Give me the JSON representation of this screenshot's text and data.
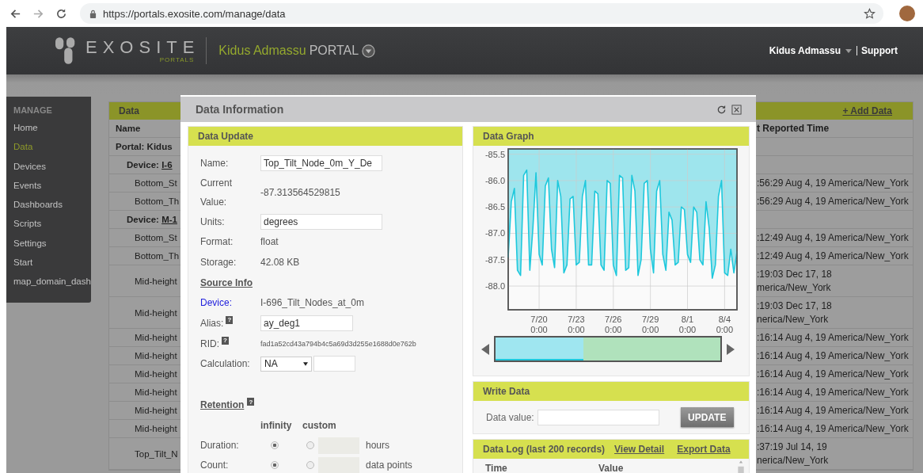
{
  "browser": {
    "url": "https://portals.exosite.com/manage/data"
  },
  "header": {
    "logo_text": "EXOSITE",
    "logo_subtext": "PORTALS",
    "portal_owner": "Kidus Admassu",
    "portal_label": "PORTAL",
    "user_menu": "Kidus Admassu",
    "support_link": "Support"
  },
  "sidebar": {
    "heading": "MANAGE",
    "items": [
      {
        "label": "Home",
        "selected": false
      },
      {
        "label": "Data",
        "selected": true
      },
      {
        "label": "Devices",
        "selected": false
      },
      {
        "label": "Events",
        "selected": false
      },
      {
        "label": "Dashboards",
        "selected": false
      },
      {
        "label": "Scripts",
        "selected": false
      },
      {
        "label": "Settings",
        "selected": false
      },
      {
        "label": "Start",
        "selected": false
      },
      {
        "label": "map_domain_dash",
        "selected": false
      }
    ]
  },
  "data_table": {
    "title": "Data",
    "add_link": "+ Add Data",
    "columns": [
      "Name",
      "t Reported Time"
    ],
    "rows": [
      {
        "kind": "portal",
        "name": "Portal: Kidus"
      },
      {
        "kind": "device",
        "name": "Device:",
        "link": "I-6"
      },
      {
        "kind": "data",
        "name": "Bottom_St",
        "time": [
          ":56:29 Aug 4, 19 America/New_York"
        ]
      },
      {
        "kind": "data",
        "name": "Bottom_Th",
        "time": [
          ":56:29 Aug 4, 19 America/New_York"
        ]
      },
      {
        "kind": "device",
        "name": "Device:",
        "link": "M-1"
      },
      {
        "kind": "data",
        "name": "Bottom_St",
        "time": [
          ":12:49 Aug 4, 19 America/New_York"
        ]
      },
      {
        "kind": "data",
        "name": "Bottom_Th",
        "time": [
          ":12:49 Aug 4, 19 America/New_York"
        ]
      },
      {
        "kind": "data",
        "name": "Mid-height",
        "time": [
          ":19:03 Dec 17, 18",
          "merica/New_York"
        ]
      },
      {
        "kind": "data",
        "name": "Mid-height",
        "time": [
          ":19:03 Dec 17, 18",
          "nerica/New_York"
        ]
      },
      {
        "kind": "data",
        "name": "Mid-height",
        "time": [
          ":16:14 Aug 4, 19 America/New_York"
        ]
      },
      {
        "kind": "data",
        "name": "Mid-height",
        "time": [
          ":16:14 Aug 4, 19 America/New_York"
        ]
      },
      {
        "kind": "data",
        "name": "Mid-height",
        "time": [
          ":16:14 Aug 4, 19 America/New_York"
        ]
      },
      {
        "kind": "data",
        "name": "Mid-height",
        "time": [
          ":16:14 Aug 4, 19 America/New_York"
        ]
      },
      {
        "kind": "data",
        "name": "Mid-height",
        "time": [
          ":16:14 Aug 4, 19 America/New_York"
        ]
      },
      {
        "kind": "data",
        "name": "Mid-height",
        "time": [
          ":16:14 Aug 4, 19 America/New_York"
        ]
      },
      {
        "kind": "data",
        "name": "Top_Tilt_N",
        "time": [
          ":37:19 Jul 14, 19",
          "nerica/New_York"
        ]
      }
    ]
  },
  "modal": {
    "title": "Data Information",
    "data_update": {
      "title": "Data Update",
      "name_label": "Name:",
      "name_value": "Top_Tilt_Node_0m_Y_De",
      "current_value_label": "Current Value:",
      "current_value": "-87.313564529815",
      "units_label": "Units:",
      "units_value": "degrees",
      "format_label": "Format:",
      "format_value": "float",
      "storage_label": "Storage:",
      "storage_value": "42.08 KB",
      "source_info_heading": "Source Info",
      "device_label": "Device:",
      "device_value": "I-696_Tilt_Nodes_at_0m",
      "alias_label": "Alias:",
      "alias_help": "?",
      "alias_value": "ay_deg1",
      "rid_label": "RID:",
      "rid_help": "?",
      "rid_value": "fad1a52cd43a794b4c5a69d3d255e1688d0e762b",
      "calculation_label": "Calculation:",
      "calculation_value": "NA",
      "retention_heading": "Retention",
      "retention_help": "?",
      "retention_columns": [
        "infinity",
        "custom"
      ],
      "retention_rows": [
        {
          "label": "Duration:",
          "options": [
            {
              "selected": true
            },
            {
              "selected": false
            }
          ],
          "unit": "hours"
        },
        {
          "label": "Count:",
          "options": [
            {
              "selected": true
            },
            {
              "selected": false
            }
          ],
          "unit": "data points"
        }
      ]
    },
    "data_graph": {
      "title": "Data Graph",
      "chart_data": {
        "type": "area",
        "grid": true,
        "ylim": [
          -88.45,
          -85.4
        ],
        "categories": [
          null,
          null,
          null,
          null,
          null,
          null,
          null,
          null,
          null,
          null,
          "7/20 0:00",
          null,
          null,
          null,
          null,
          null,
          null,
          null,
          null,
          null,
          null,
          null,
          "7/23 0:00",
          null,
          null,
          null,
          null,
          null,
          null,
          null,
          null,
          null,
          null,
          null,
          "7/26 0:00",
          null,
          null,
          null,
          null,
          null,
          null,
          null,
          null,
          null,
          null,
          null,
          "7/29 0:00",
          null,
          null,
          null,
          null,
          null,
          null,
          null,
          null,
          null,
          null,
          null,
          "8/1 0:00",
          null,
          null,
          null,
          null,
          null,
          null,
          null,
          null,
          null,
          null,
          null,
          "8/4 0:00",
          null,
          null,
          null,
          null
        ],
        "yticks": [
          {
            "value": -85.5,
            "label": "-85.5"
          },
          {
            "value": -86,
            "label": "-86.0"
          },
          {
            "value": -86.5,
            "label": "-86.5"
          },
          {
            "value": -87,
            "label": "-87.0"
          },
          {
            "value": -87.5,
            "label": "-87.5"
          },
          {
            "value": -88,
            "label": "-88.0"
          }
        ],
        "series": [
          {
            "color": "#1ec8dc",
            "values": [
              -87.45,
              -86.4,
              -86.15,
              -87.7,
              -87.8,
              -85.9,
              -85.8,
              -87.7,
              -86.9,
              -85.85,
              -87.4,
              -87.6,
              -86.1,
              -85.95,
              -87.3,
              -87.65,
              -86.0,
              -86.3,
              -87.75,
              -87.6,
              -86.35,
              -86.3,
              -87.6,
              -87.55,
              -86.3,
              -86.0,
              -87.6,
              -87.6,
              -86.2,
              -86.25,
              -87.6,
              -87.7,
              -86.0,
              -86.05,
              -87.6,
              -87.8,
              -85.9,
              -85.95,
              -87.7,
              -87.65,
              -85.9,
              -86.2,
              -87.8,
              -87.5,
              -86.05,
              -86.0,
              -87.3,
              -87.75,
              -86.2,
              -86.0,
              -87.4,
              -87.7,
              -86.6,
              -86.75,
              -87.6,
              -87.55,
              -86.5,
              -86.55,
              -87.4,
              -87.55,
              -86.5,
              -86.6,
              -87.5,
              -87.6,
              -86.4,
              -86.9,
              -87.85,
              -87.6,
              -86.3,
              -86.0,
              -87.75,
              -87.8,
              -87.3,
              -87.75,
              -87.35
            ]
          }
        ]
      }
    },
    "write_data": {
      "title": "Write Data",
      "value_label": "Data value:",
      "button": "UPDATE"
    },
    "data_log": {
      "title": "Data Log (last 200 records)",
      "view_detail_link": "View Detail",
      "export_link": "Export Data",
      "columns": [
        "Time",
        "Value"
      ]
    }
  }
}
